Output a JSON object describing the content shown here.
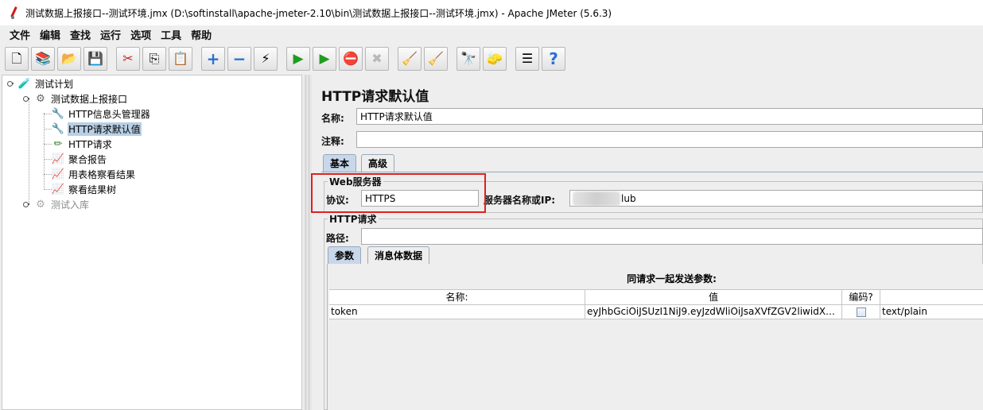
{
  "window": {
    "title": "测试数据上报接口--测试环境.jmx (D:\\softinstall\\apache-jmeter-2.10\\bin\\测试数据上报接口--测试环境.jmx) - Apache JMeter (5.6.3)"
  },
  "menu": [
    "文件",
    "编辑",
    "查找",
    "运行",
    "选项",
    "工具",
    "帮助"
  ],
  "toolbar": {
    "buttons": [
      {
        "icon": "new-document-icon",
        "glyph": "🗋"
      },
      {
        "icon": "templates-icon",
        "glyph": "📚"
      },
      {
        "icon": "open-folder-icon",
        "glyph": "📂"
      },
      {
        "icon": "save-icon",
        "glyph": "💾"
      },
      {
        "icon": "cut-icon",
        "glyph": "✂"
      },
      {
        "icon": "copy-icon",
        "glyph": "⎘"
      },
      {
        "icon": "paste-icon",
        "glyph": "📋"
      },
      {
        "icon": "expand-icon",
        "glyph": "+"
      },
      {
        "icon": "collapse-icon",
        "glyph": "−"
      },
      {
        "icon": "toggle-icon",
        "glyph": "⚡"
      },
      {
        "icon": "start-icon",
        "glyph": "▶"
      },
      {
        "icon": "start-no-pauses-icon",
        "glyph": "▶"
      },
      {
        "icon": "stop-icon",
        "glyph": "⛔"
      },
      {
        "icon": "shutdown-icon",
        "glyph": "✖"
      },
      {
        "icon": "clear-icon",
        "glyph": "🧹"
      },
      {
        "icon": "clear-all-icon",
        "glyph": "🧹"
      },
      {
        "icon": "search-binoculars-icon",
        "glyph": "🔭"
      },
      {
        "icon": "reset-search-broom-icon",
        "glyph": "🧽"
      },
      {
        "icon": "function-helper-icon",
        "glyph": "☰"
      },
      {
        "icon": "help-icon",
        "glyph": "?"
      }
    ]
  },
  "tree": {
    "nodes": [
      {
        "label": "测试计划",
        "icon": "test-plan-icon",
        "glyph": "🧪"
      },
      {
        "label": "测试数据上报接口",
        "icon": "thread-group-gear-icon",
        "glyph": "⚙"
      },
      {
        "label": "HTTP信息头管理器",
        "icon": "config-wrench-icon",
        "glyph": "🔧"
      },
      {
        "label": "HTTP请求默认值",
        "icon": "config-wrench-icon",
        "glyph": "🔧"
      },
      {
        "label": "HTTP请求",
        "icon": "sampler-pen-icon",
        "glyph": "✏"
      },
      {
        "label": "聚合报告",
        "icon": "listener-chart-icon",
        "glyph": "📈"
      },
      {
        "label": "用表格察看结果",
        "icon": "listener-chart-icon",
        "glyph": "📈"
      },
      {
        "label": "察看结果树",
        "icon": "listener-chart-icon",
        "glyph": "📈"
      },
      {
        "label": "测试入库",
        "icon": "thread-group-gear-icon",
        "glyph": "⚙"
      }
    ],
    "selected": "HTTP请求默认值"
  },
  "panel": {
    "title": "HTTP请求默认值",
    "name_label": "名称:",
    "name_value": "HTTP请求默认值",
    "comment_label": "注释:",
    "comment_value": "",
    "tabs": [
      "基本",
      "高级"
    ],
    "web_server_group": "Web服务器",
    "protocol_label": "协议:",
    "protocol_value": "HTTPS",
    "server_label": "服务器名称或IP:",
    "server_value_visible": "lub",
    "http_request_group": "HTTP请求",
    "path_label": "路径:",
    "path_value": "",
    "subtabs": [
      "参数",
      "消息体数据"
    ],
    "params_caption": "同请求一起发送参数:",
    "columns": [
      "名称:",
      "值",
      "编码?",
      ""
    ],
    "rows": [
      {
        "name": "token",
        "value": "eyJhbGciOiJSUzI1NiJ9.eyJzdWliOiJsaXVfZGV2liwidXNlck...",
        "encode": false,
        "content_type": "text/plain"
      }
    ]
  },
  "colors": {
    "highlight": "#e02020",
    "selection": "#b8cfe5",
    "active_tab": "#c8d7ea"
  }
}
